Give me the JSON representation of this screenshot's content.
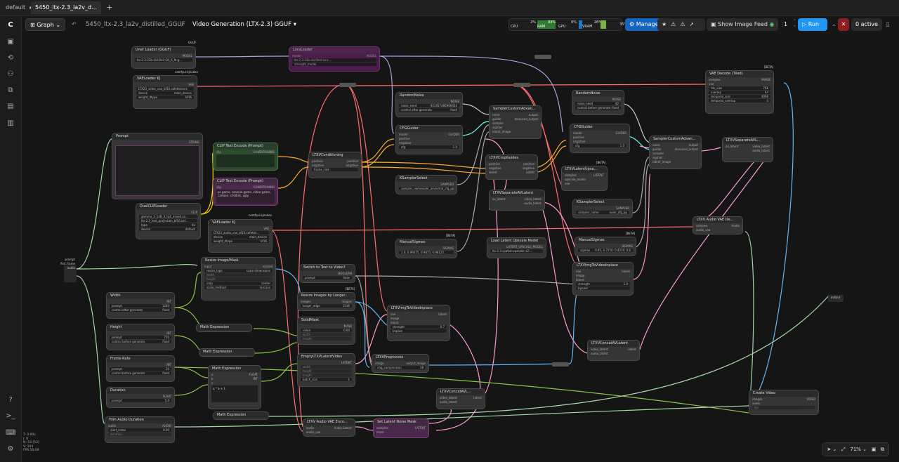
{
  "tabs": [
    {
      "label": "default"
    },
    {
      "label": "5450_ltx-2.3_la2v_d..."
    }
  ],
  "topbar": {
    "graph_label": "Graph",
    "breadcrumb_root": "5450_ltx-2.3_la2v_distilled_GGUF",
    "breadcrumb_sep": "/",
    "workflow_title": "Video Generation (LTX-2.3) GGUF",
    "cpu_pct": "2%",
    "cpu_label": "CPU",
    "ram_pct": "93%",
    "ram_label": "RAM",
    "gpu_pct": "0%",
    "gpu_label": "GPU",
    "vram_pct": "26%",
    "vram_label": "VRAM",
    "temp": "35°",
    "manager_label": "Manager",
    "image_feed_label": "Show Image Feed",
    "queue_count": "1",
    "run_label": "Run",
    "active_label": "0 active"
  },
  "zoom": {
    "level": "71%"
  },
  "info": {
    "t": "T: 0.00s",
    "i": "I: 0",
    "n": "N: 53 [53]",
    "v": "V: 104",
    "fps": "FPS:50.69"
  },
  "inputs": {
    "prompt": "prompt",
    "first_frame": "first frame",
    "audio": "audio"
  },
  "nodes": {
    "unet": {
      "title": "Unet Loader (GGUF)",
      "badge": "GGUF",
      "out": "MODEL",
      "w1": "ltx-2.3-22b-distilled-Q4_K_M.g..."
    },
    "lora": {
      "title": "LoraLoader",
      "in": "model",
      "out": "MODEL",
      "w1": "ltx-2.3-22b-distilled-lora-...",
      "w2": "strength_model"
    },
    "vae": {
      "title": "VAELoader KJ",
      "badge": "comfyui-kjnodes",
      "out": "VAE",
      "w1": "LTX23_video_vae_bf16.safetensors",
      "w2": "device",
      "w2v": "main_device",
      "w3": "weight_dtype",
      "w3v": "bf16"
    },
    "prompt": {
      "title": "Prompt",
      "out": "STRING"
    },
    "clip_pos": {
      "title": "CLIP Text Encode (Prompt)",
      "in": "clip",
      "out": "CONDITIONING"
    },
    "clip_neg": {
      "title": "CLIP Text Encode (Prompt)",
      "in": "clip",
      "out": "CONDITIONING",
      "text": "pc game, console game, video game, cartoon, childish, ugly"
    },
    "dualclip": {
      "title": "DualCLIPLoader",
      "out": "CLIP",
      "w1": "gemma_3_12B_it_fp4_mixed.sa...",
      "w2": "ltx-2.3_text_projection_bf16.saf...",
      "w3": "type",
      "w3v": "ltx",
      "w4": "device",
      "w4v": "default"
    },
    "vae_audio": {
      "title": "VAELoader KJ",
      "badge": "comfyui-kjnodes",
      "out": "VAE",
      "w1": "LTX23_audio_vae_bf16.safeten...",
      "w2": "device",
      "w2v": "main_device",
      "w3": "weight_dtype",
      "w3v": "bf16"
    },
    "ltxvcond": {
      "title": "LTXVConditioning",
      "in1": "positive",
      "in2": "negative",
      "out1": "positive",
      "out2": "negative",
      "w1": "frame_rate"
    },
    "randnoise1": {
      "title": "RandomNoise",
      "out": "NOISE",
      "w1": "noise_seed",
      "w1v": "923457485966434",
      "w2": "control after generate",
      "w2v": "fixed"
    },
    "cfg1": {
      "title": "CFGGuider",
      "in1": "model",
      "in2": "positive",
      "in3": "negative",
      "out": "GUIDER",
      "w1": "cfg",
      "w1v": "1.0"
    },
    "ksel1": {
      "title": "KSamplerSelect",
      "out": "SAMPLER",
      "w1": "sampler_name",
      "w1v": "euler_ancestral_cfg_pp"
    },
    "manualsig1": {
      "title": "ManualSigmas",
      "badge": "[BETA]",
      "out": "SIGMAS",
      "w1": "sigmas",
      "w1v": "1.0, 0.99375, 0.9875, 0.98125..."
    },
    "samp1": {
      "title": "SamplerCustomAdvan...",
      "in1": "noise",
      "in2": "guider",
      "in3": "sampler",
      "in4": "sigmas",
      "in5": "latent_image",
      "out1": "output",
      "out2": "denoised_output"
    },
    "cropguides1": {
      "title": "LTXVCropGuides",
      "in1": "positive",
      "in2": "negative",
      "in3": "latent",
      "out1": "positive",
      "out2": "negative",
      "out3": "latent"
    },
    "sepav1": {
      "title": "LTXVSeparateAVLatent",
      "in": "av_latent",
      "out1": "video_latent",
      "out2": "audio_latent"
    },
    "loadups": {
      "title": "Load Latent Upscale Model",
      "out": "LATENT_UPSCALE_MODEL",
      "w1": "ltx-2.3-spatial-upscaler-x2-..."
    },
    "randnoise2": {
      "title": "RandomNoise",
      "out": "NOISE",
      "w1": "noise_seed",
      "w1v": "42",
      "w2": "control before generate",
      "w2v": "fixed"
    },
    "cfg2": {
      "title": "CFGGuider",
      "in1": "model",
      "in2": "positive",
      "in3": "negative",
      "out": "GUIDER",
      "w1": "cfg",
      "w1v": "1.0"
    },
    "latentups": {
      "title": "LTXVLatentUpsa...",
      "badge": "[BETA]",
      "in1": "samples",
      "in2": "upscale_model",
      "in3": "vae",
      "out": "LATENT"
    },
    "ksel2": {
      "title": "KSamplerSelect",
      "out": "SAMPLER",
      "w1": "sampler_name",
      "w1v": "euler_cfg_pp"
    },
    "manualsig2": {
      "title": "ManualSigmas",
      "badge": "[BETA]",
      "out": "SIGMAS",
      "w1": "sigmas",
      "w1v": "0.85, 0.7250, 0.4219, 0.0"
    },
    "samp2": {
      "title": "SamplerCustomAdvan...",
      "in1": "noise",
      "in2": "guider",
      "in3": "sampler",
      "in4": "sigmas",
      "in5": "latent_image",
      "out1": "output",
      "out2": "denoised_output"
    },
    "sepav2": {
      "title": "LTXVSeparateAVL...",
      "in": "av_latent",
      "out1": "video_latent",
      "out2": "audio_latent"
    },
    "vaedecode": {
      "title": "VAE Decode (Tiled)",
      "badge": "[BETA]",
      "in1": "samples",
      "in2": "vae",
      "out": "IMAGE",
      "w1": "tile_size",
      "w1v": "768",
      "w2": "overlap",
      "w2v": "64",
      "w3": "temporal_size",
      "w3v": "4096",
      "w4": "temporal_overlap",
      "w4v": "4"
    },
    "audiovaedec": {
      "title": "LTXV Audio VAE De...",
      "in1": "samples",
      "in2": "audio_vae",
      "out": "Audio"
    },
    "inplace2": {
      "title": "LTXVImgToVideoInplace",
      "in1": "vae",
      "in2": "image",
      "in3": "latent",
      "out": "latent",
      "w1": "strength",
      "w1v": "1.0",
      "w2": "bypass"
    },
    "concat2": {
      "title": "LTXVConcatAVLatent",
      "in1": "video_latent",
      "in2": "audio_latent",
      "out": "latent"
    },
    "resize": {
      "title": "Resize Image/Mask",
      "in": "input",
      "out": "resized",
      "w1": "resize_type",
      "w1v": "scale dimensions",
      "w2": "width",
      "w3": "height",
      "w4": "crop",
      "w4v": "center",
      "w5": "scale_method",
      "w5v": "lanczos"
    },
    "switch": {
      "title": "Switch to Text to Video?",
      "out": "BOOLEAN",
      "w1": "prompt",
      "w1v": "false"
    },
    "resizelong": {
      "title": "Resize Images by Longer...",
      "badge": "[BETA]",
      "in": "images",
      "out": "images",
      "w1": "longer_edge",
      "w1v": "1536"
    },
    "solidmask": {
      "title": "SolidMask",
      "out": "MASK",
      "w1": "value",
      "w1v": "0.00",
      "w2": "width",
      "w3": "height"
    },
    "emptylatent": {
      "title": "EmptyLTXVLatentVideo",
      "out": "LATENT",
      "w1": "width",
      "w2": "height",
      "w3": "length",
      "w4": "batch_size",
      "w4v": "1"
    },
    "inplace1": {
      "title": "LTXVImgToVideoInplace",
      "in1": "vae",
      "in2": "image",
      "in3": "latent",
      "out": "latent",
      "w1": "strength",
      "w1v": "0.7",
      "w2": "bypass"
    },
    "preprocess": {
      "title": "LTXVPreprocess",
      "in": "image",
      "out": "output_image",
      "w1": "img_compression",
      "w1v": "18"
    },
    "concat1": {
      "title": "LTXVConcatAVL...",
      "in1": "video_latent",
      "in2": "audio_latent",
      "out": "latent"
    },
    "width": {
      "title": "Width",
      "out": "INT",
      "w1": "prompt",
      "w1v": "1280",
      "w2": "control after generate",
      "w2v": "fixed"
    },
    "height": {
      "title": "Height",
      "out": "INT",
      "w1": "prompt",
      "w1v": "720",
      "w2": "control before generate",
      "w2v": "fixed"
    },
    "framerate": {
      "title": "Frame Rate",
      "out": "INT",
      "w1": "prompt",
      "w1v": "24",
      "w2": "control before generate",
      "w2v": "fixed"
    },
    "duration": {
      "title": "Duration",
      "out": "FLOAT",
      "w1": "prompt",
      "w1v": "5.0"
    },
    "trim": {
      "title": "Trim Audio Duration",
      "in": "audio",
      "out": "AUDIO",
      "w1": "start_index",
      "w1v": "0.00",
      "w2": "duration"
    },
    "math1": {
      "title": "Math Expression"
    },
    "math2": {
      "title": "Math Expression"
    },
    "math3": {
      "title": "Math Expression",
      "in1": "a",
      "in2": "b",
      "in3": "c",
      "out1": "FLOAT",
      "out2": "INT",
      "expr": "a * b + 1"
    },
    "math4": {
      "title": "Math Expression"
    },
    "audioenc": {
      "title": "LTXV Audio VAE Enco...",
      "in1": "audio",
      "in2": "audio_vae",
      "out": "Audio Latent"
    },
    "setmask": {
      "title": "Set Latent Noise Mask",
      "in1": "samples",
      "in2": "mask",
      "out": "LATENT"
    },
    "createvideo": {
      "title": "Create Video",
      "in1": "images",
      "in2": "audio",
      "in3": "fps",
      "out": "VIDEO"
    },
    "output": {
      "label": "output"
    }
  },
  "colors": {
    "vae": "#ff6e6e",
    "model": "#b39ddb",
    "latent": "#ff9ad5",
    "conditioning": "#ffa931",
    "image": "#64b5f6",
    "noise": "#cccccc",
    "guider": "#66ffee",
    "clip": "#ffd500",
    "int": "#8bc34a"
  }
}
